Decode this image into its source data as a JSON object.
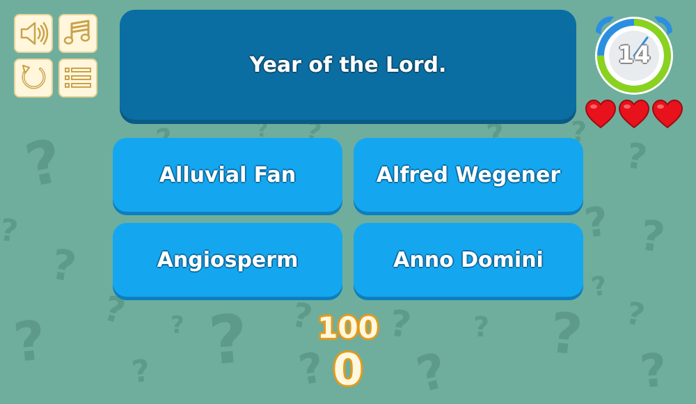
{
  "toolbar": {
    "sound_icon": "speaker-icon",
    "music_icon": "music-note-icon",
    "restart_icon": "restart-icon",
    "menu_icon": "menu-list-icon"
  },
  "question": {
    "text": "Year of the Lord."
  },
  "answers": [
    {
      "label": "Alluvial Fan"
    },
    {
      "label": "Alfred Wegener"
    },
    {
      "label": "Angiosperm"
    },
    {
      "label": "Anno Domini"
    }
  ],
  "timer": {
    "seconds": "14",
    "fraction_remaining": 0.75
  },
  "lives": {
    "count": 3,
    "max": 3
  },
  "score": {
    "points_value": "100",
    "total": "0"
  },
  "colors": {
    "background": "#6fae9d",
    "question_bg": "#0a6ea3",
    "answer_bg": "#14a7f0",
    "score_outline": "#e69a18",
    "heart": "#e8121c",
    "timer_ring_green": "#8ad21e",
    "timer_ring_blue": "#2b8fe0"
  }
}
